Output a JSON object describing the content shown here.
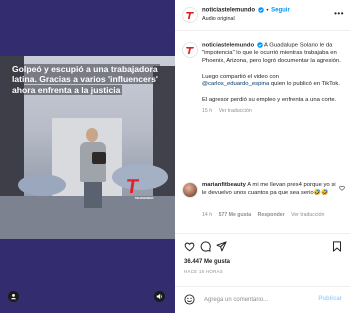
{
  "media": {
    "headline": "Golpeó y escupió a una trabajadora latina. Gracias a varios 'influencers' ahora enfrenta a la justicia",
    "logo_letter": "T",
    "logo_tagline": "TELEMUNDO",
    "background_color": "#332c6e"
  },
  "header": {
    "username": "noticiastelemundo",
    "separator": "•",
    "follow_label": "Seguir",
    "audio_label": "Audio original",
    "more_label": "•••"
  },
  "caption": {
    "username": "noticiastelemundo",
    "paragraph1": "A Guadalupe Solano le da \"impotencia\" lo que le ocurrió mientras trabajaba en Phoenix, Arizona, pero logró documentar la agresión.",
    "paragraph2_before": "Luego compartió el video con ",
    "paragraph2_link": "@carlos_eduardo_espina",
    "paragraph2_after": " quien lo publicó en TikTok.",
    "paragraph3": "El agresor perdió su empleo y enfrenta a una corte.",
    "time_ago": "15 h",
    "see_translation": "Ver traducción"
  },
  "comment": {
    "username": "marianfitbeauty",
    "text": "A mi me llevan pres4 porque yo si le devuelvo unos cuantos pa que sea serio🤣🤣",
    "time_ago": "14 h",
    "likes": "577 Me gusta",
    "reply": "Responder",
    "see_translation": "Ver traducción"
  },
  "actions": {
    "likes": "36.447 Me gusta",
    "timestamp": "HACE 15 HORAS"
  },
  "composer": {
    "placeholder": "Agrega un comentario...",
    "publish_label": "Publicar"
  },
  "colors": {
    "accent": "#0095f6",
    "link": "#00376b",
    "muted": "#8e8e8e",
    "brand_red": "#e0202a"
  }
}
